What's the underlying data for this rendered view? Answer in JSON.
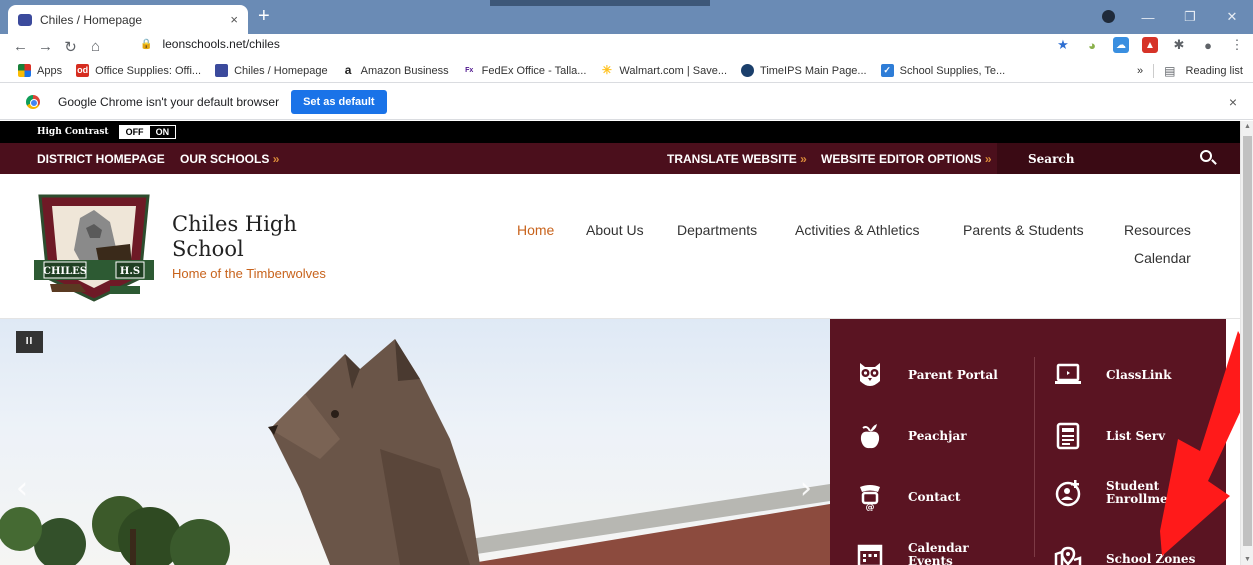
{
  "browser": {
    "tab_title": "Chiles / Homepage",
    "tab_close": "×",
    "new_tab": "+",
    "url": "leonschools.net/chiles",
    "bookmarks": [
      {
        "label": "Apps",
        "icon": "apps-grid-icon",
        "color": "#d93025"
      },
      {
        "label": "Office Supplies: Offi...",
        "icon": "office-depot-icon",
        "color": "#d62d20"
      },
      {
        "label": "Chiles / Homepage",
        "icon": "school-favicon-icon",
        "color": "#3b4a9c"
      },
      {
        "label": "Amazon Business",
        "icon": "amazon-icon",
        "color": "#222222"
      },
      {
        "label": "FedEx Office - Talla...",
        "icon": "fedex-icon",
        "color": "#4d148c"
      },
      {
        "label": "Walmart.com | Save...",
        "icon": "walmart-icon",
        "color": "#ffc220"
      },
      {
        "label": "TimeIPS Main Page...",
        "icon": "timeips-icon",
        "color": "#1b3f6b"
      },
      {
        "label": "School Supplies, Te...",
        "icon": "school-supplies-icon",
        "color": "#2e7dd7"
      }
    ],
    "bookmarks_more": "»",
    "reading_list": "Reading list",
    "infobar_message": "Google Chrome isn't your default browser",
    "set_default_label": "Set as default",
    "infobar_close": "×"
  },
  "site": {
    "high_contrast_label": "High Contrast",
    "hc_off": "OFF",
    "hc_on": "ON",
    "district_nav": {
      "district_homepage": "DISTRICT HOMEPAGE",
      "our_schools": "OUR SCHOOLS",
      "translate": "TRANSLATE WEBSITE",
      "editor_options": "WEBSITE EDITOR OPTIONS",
      "arrow": "»",
      "search_label": "Search"
    },
    "school_name": "Chiles High School",
    "tagline": "Home of the Timberwolves",
    "main_nav": {
      "home": "Home",
      "about": "About Us",
      "departments": "Departments",
      "activities": "Activities & Athletics",
      "parents": "Parents & Students",
      "resources": "Resources",
      "calendar": "Calendar"
    },
    "hero": {
      "pause": "II",
      "prev": "‹",
      "next": "›"
    },
    "quick_links": {
      "parent_portal": "Parent Portal",
      "classlink": "ClassLink",
      "peachjar": "Peachjar",
      "list_serv": "List Serv",
      "contact": "Contact",
      "student_enrollment_1": "Student",
      "student_enrollment_2": "Enrollment",
      "calendar_events_1": "Calendar",
      "calendar_events_2": "Events",
      "school_zones": "School Zones"
    },
    "colors": {
      "maroon": "#4b0f1c",
      "panel": "#5a1422",
      "accent_orange": "#c8631c",
      "annotation_red": "#ff1a1a"
    }
  }
}
